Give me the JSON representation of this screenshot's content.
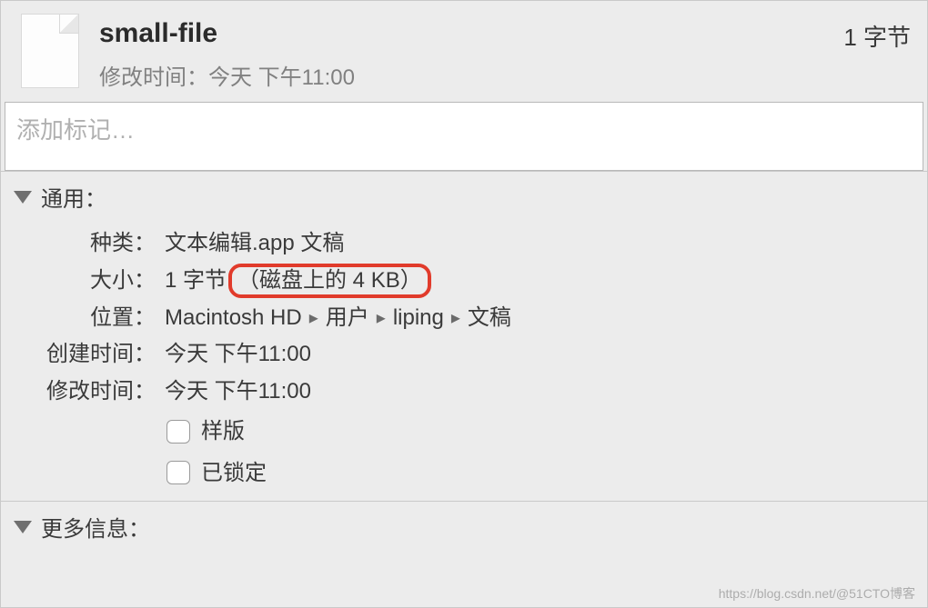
{
  "header": {
    "file_name": "small-file",
    "modified_label": "修改时间",
    "modified_value": "今天 下午11:00",
    "size_top": "1 字节"
  },
  "tags": {
    "placeholder": "添加标记…"
  },
  "general": {
    "title": "通用",
    "rows": {
      "kind_label": "种类",
      "kind_value": "文本编辑.app 文稿",
      "size_label": "大小",
      "size_value": "1 字节",
      "size_disk": "（磁盘上的 4 KB）",
      "where_label": "位置",
      "where_path": [
        "Macintosh HD",
        "用户",
        "liping",
        "文稿"
      ],
      "created_label": "创建时间",
      "created_value": "今天 下午11:00",
      "modified_label": "修改时间",
      "modified_value": "今天 下午11:00"
    },
    "checks": {
      "stationery": "样版",
      "locked": "已锁定"
    }
  },
  "more_info": {
    "title": "更多信息"
  },
  "watermark": "https://blog.csdn.net/@51CTO博客"
}
